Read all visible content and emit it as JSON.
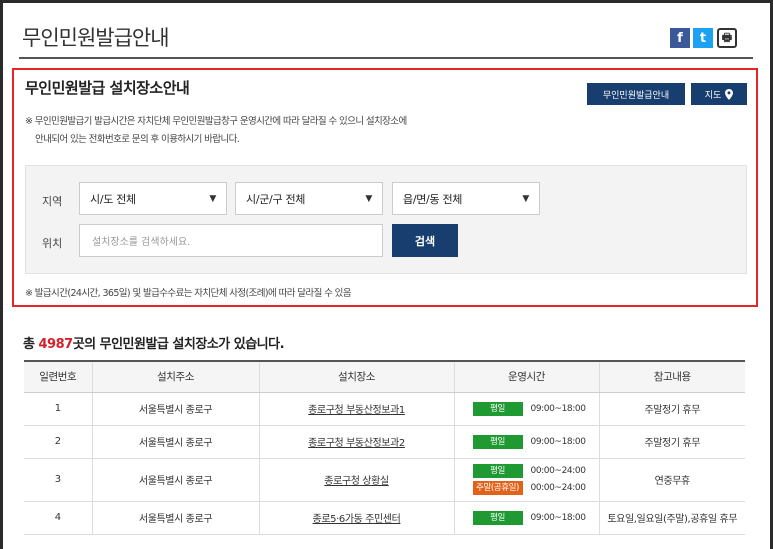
{
  "header": {
    "title": "무인민원발급안내",
    "share": {
      "facebook": "f",
      "twitter": "t",
      "print": "🖶"
    }
  },
  "panel": {
    "title": "무인민원발급 설치장소안내",
    "guide_button": "무인민원발급안내",
    "map_button": "지도",
    "notice_line1": "※ 무인민원발급기 발급시간은 자치단체 무인민원발급창구 운영시간에 따라 달라질 수 있으니 설치장소에",
    "notice_line2": "안내되어 있는 전화번호로 문의 후 이용하시기 바랍니다.",
    "region_label": "지역",
    "sido_select": "시/도 전체",
    "sigungu_select": "시/군/구 전체",
    "eupmyeondong_select": "읍/면/동 전체",
    "location_label": "위치",
    "search_placeholder": "설치장소를 검색하세요.",
    "search_button": "검색",
    "footnote": "※ 발급시간(24시간, 365일) 및 발급수수료는 자치단체 사정(조례)에 따라 달라질 수 있음"
  },
  "summary": {
    "prefix": "총 ",
    "count": "4987",
    "suffix": "곳의 무인민원발급 설치장소가 있습니다."
  },
  "table": {
    "headers": [
      "일련번호",
      "설치주소",
      "설치장소",
      "운영시간",
      "참고내용"
    ],
    "rows": [
      {
        "no": "1",
        "address": "서울특별시 종로구",
        "place": "종로구청 부동산정보과1",
        "hours": [
          {
            "badge": "평일",
            "time": "09:00~18:00"
          }
        ],
        "note": "주말정기 휴무"
      },
      {
        "no": "2",
        "address": "서울특별시 종로구",
        "place": "종로구청 부동산정보과2",
        "hours": [
          {
            "badge": "평일",
            "time": "09:00~18:00"
          }
        ],
        "note": "주말정기 휴무"
      },
      {
        "no": "3",
        "address": "서울특별시 종로구",
        "place": "종로구청 상황실",
        "hours": [
          {
            "badge": "평일",
            "time": "00:00~24:00"
          },
          {
            "badge": "주말(공휴일)",
            "time": "00:00~24:00"
          }
        ],
        "note": "연중무휴"
      },
      {
        "no": "4",
        "address": "서울특별시 종로구",
        "place": "종로5·6가동 주민센터",
        "hours": [
          {
            "badge": "평일",
            "time": "09:00~18:00"
          }
        ],
        "note": "토요일,일요일(주말),공휴일 휴무"
      }
    ]
  },
  "colors": {
    "navy": "#173e6e",
    "red_border": "#e4262b",
    "green_badge": "#1f9a33",
    "orange_badge": "#e3621a"
  }
}
